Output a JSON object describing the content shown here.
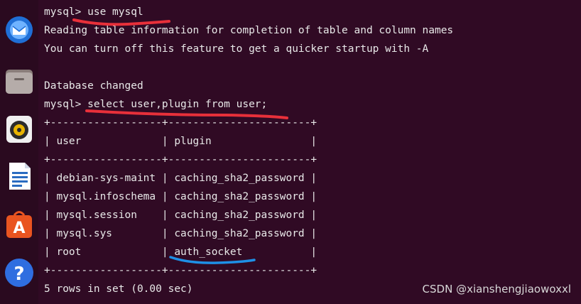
{
  "dock": {
    "icons": [
      {
        "name": "thunderbird-icon"
      },
      {
        "name": "files-icon"
      },
      {
        "name": "rhythmbox-icon"
      },
      {
        "name": "writer-icon"
      },
      {
        "name": "app-center-icon",
        "glyph": "A"
      },
      {
        "name": "help-icon",
        "glyph": "?"
      }
    ]
  },
  "terminal": {
    "lines": [
      "mysql> use mysql",
      "Reading table information for completion of table and column names",
      "You can turn off this feature to get a quicker startup with -A",
      "",
      "Database changed",
      "mysql> select user,plugin from user;",
      "+------------------+-----------------------+",
      "| user             | plugin                |",
      "+------------------+-----------------------+",
      "| debian-sys-maint | caching_sha2_password |",
      "| mysql.infoschema | caching_sha2_password |",
      "| mysql.session    | caching_sha2_password |",
      "| mysql.sys        | caching_sha2_password |",
      "| root             | auth_socket           |",
      "+------------------+-----------------------+",
      "5 rows in set (0.00 sec)"
    ]
  },
  "watermark": "CSDN @xianshengjiaowoxxl",
  "colors": {
    "background": "#300a24",
    "text": "#e8e8e8",
    "red_underline": "#e8303a",
    "blue_underline": "#1e90e6"
  }
}
